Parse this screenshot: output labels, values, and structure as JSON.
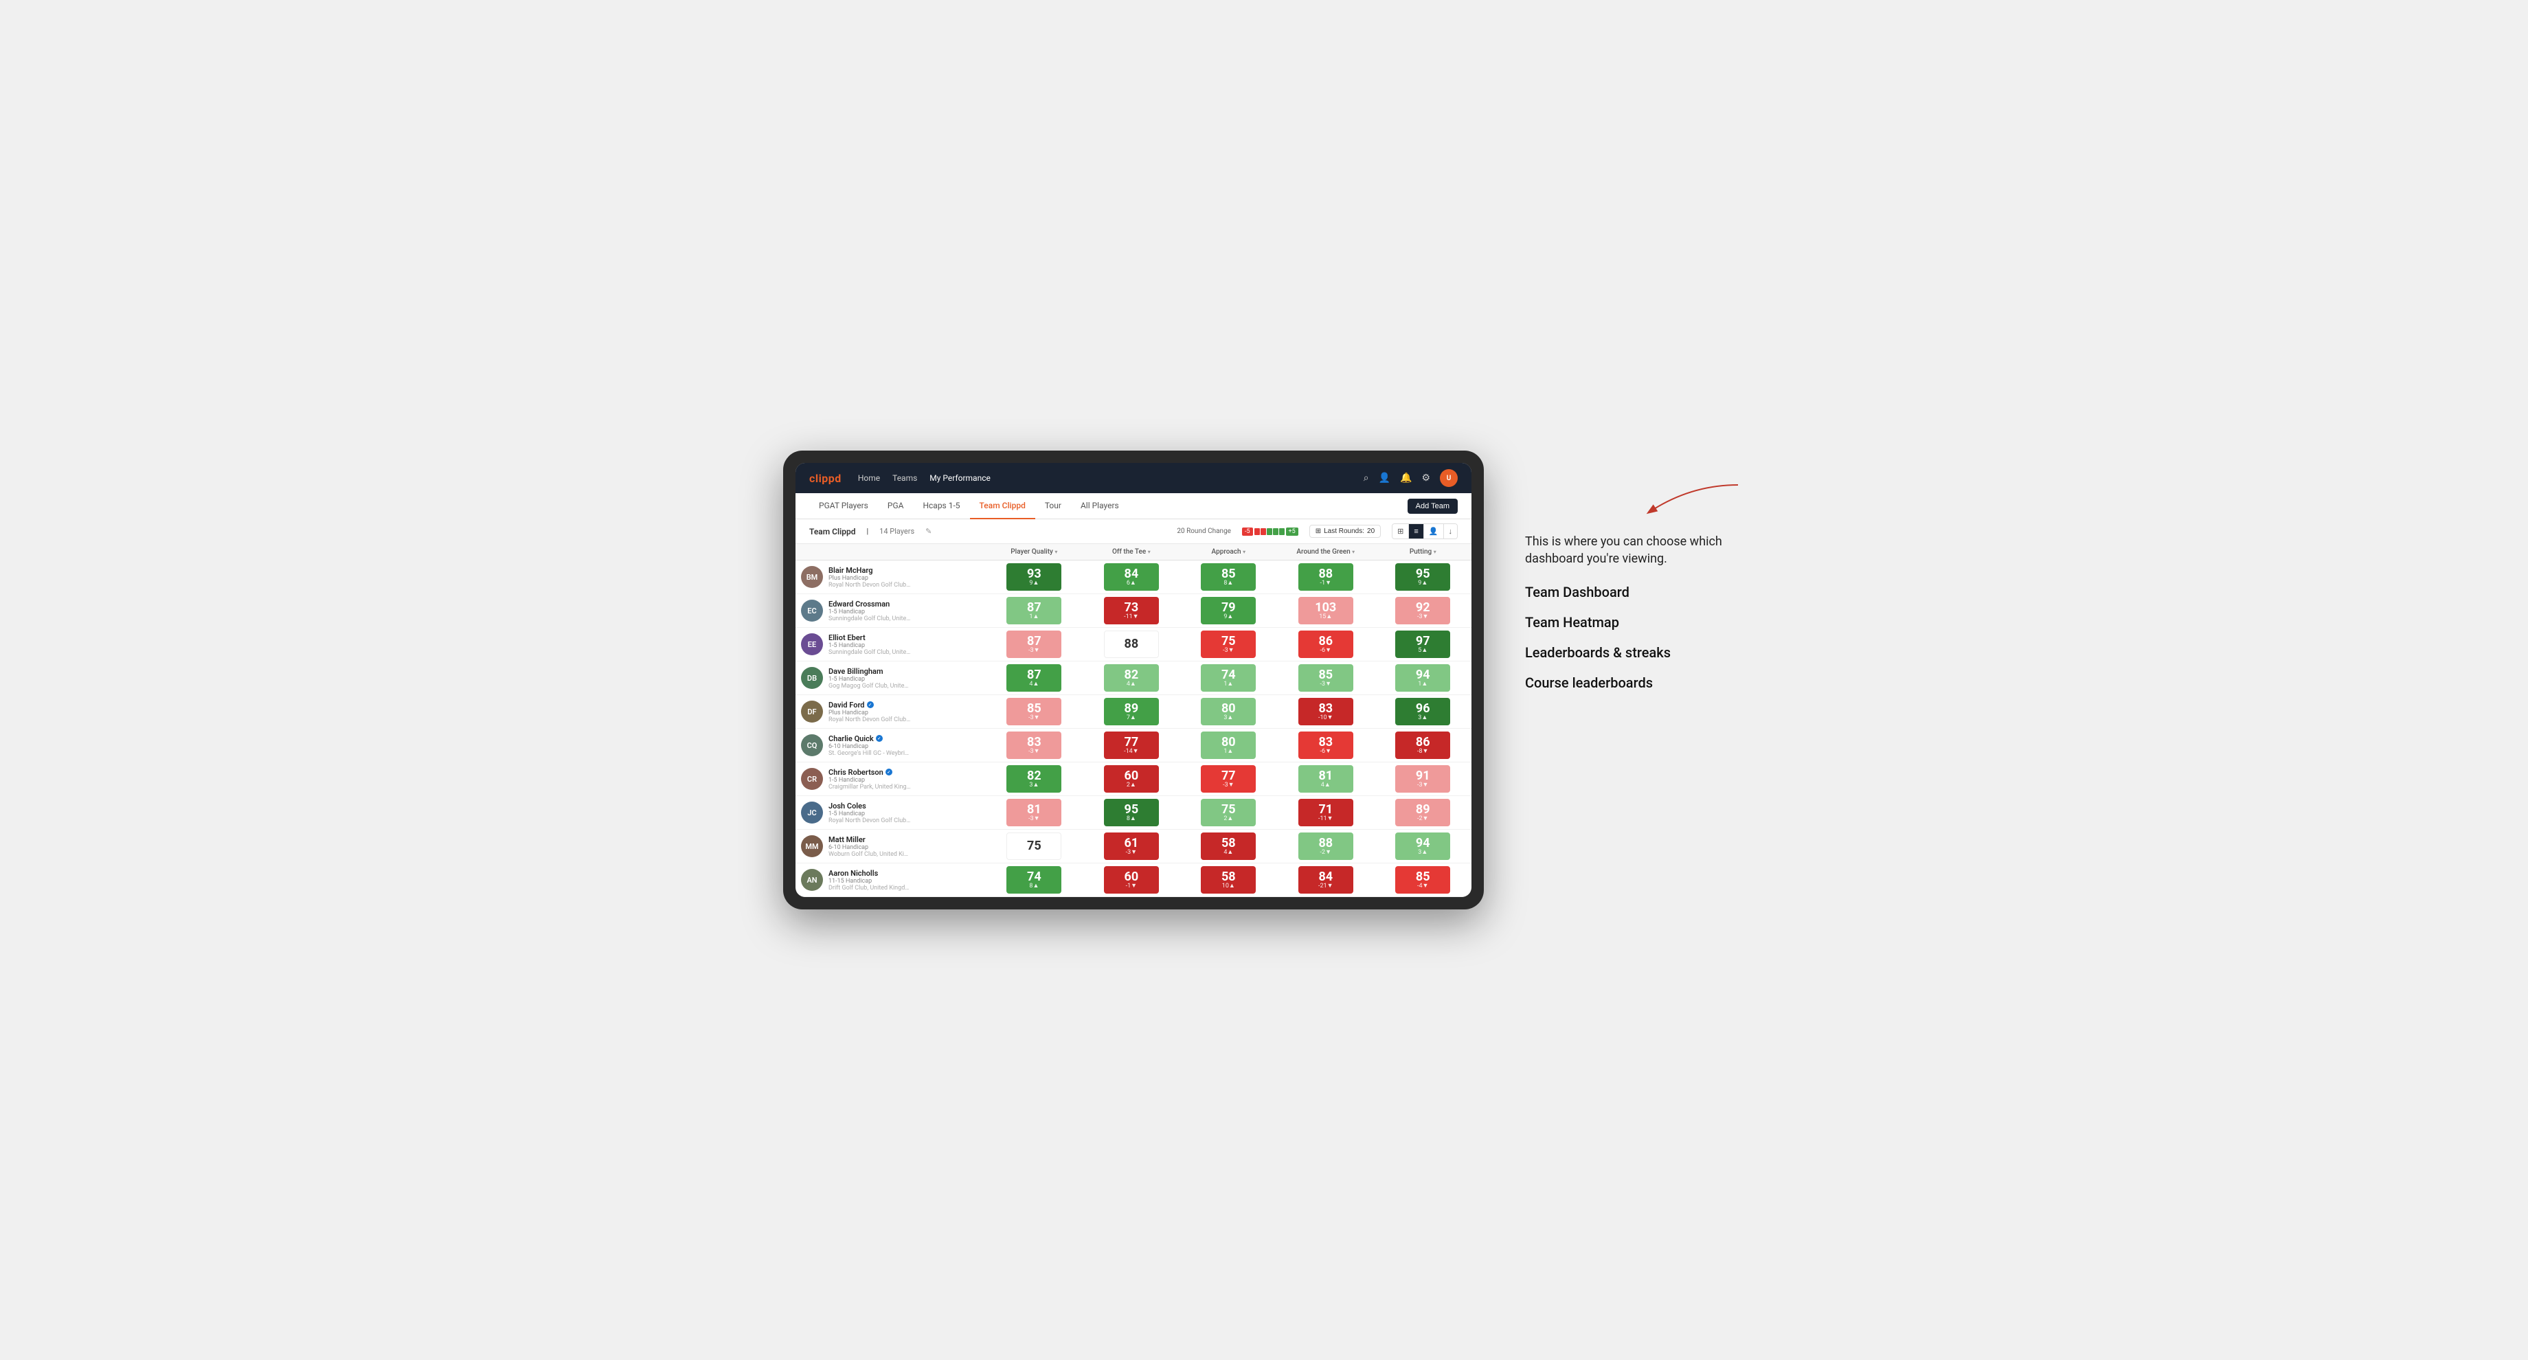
{
  "annotation": {
    "description": "This is where you can choose which dashboard you're viewing.",
    "menu_items": [
      "Team Dashboard",
      "Team Heatmap",
      "Leaderboards & streaks",
      "Course leaderboards"
    ]
  },
  "nav": {
    "logo": "clippd",
    "links": [
      "Home",
      "Teams",
      "My Performance"
    ],
    "active_link": "My Performance"
  },
  "sub_nav": {
    "links": [
      "PGAT Players",
      "PGA",
      "Hcaps 1-5",
      "Team Clippd",
      "Tour",
      "All Players"
    ],
    "active_link": "Team Clippd",
    "add_team_label": "Add Team"
  },
  "team_header": {
    "team_name": "Team Clippd",
    "separator": "|",
    "player_count": "14 Players",
    "round_change_label": "20 Round Change",
    "change_neg": "-5",
    "change_pos": "+5",
    "last_rounds_label": "Last Rounds:",
    "last_rounds_value": "20"
  },
  "table": {
    "columns": [
      {
        "label": "Player Quality",
        "sortable": true
      },
      {
        "label": "Off the Tee",
        "sortable": true
      },
      {
        "label": "Approach",
        "sortable": true
      },
      {
        "label": "Around the Green",
        "sortable": true
      },
      {
        "label": "Putting",
        "sortable": true
      }
    ],
    "players": [
      {
        "name": "Blair McHarg",
        "handicap": "Plus Handicap",
        "club": "Royal North Devon Golf Club, United Kingdom",
        "avatar_color": "#8d6e63",
        "initials": "BM",
        "verified": false,
        "scores": [
          {
            "value": "93",
            "delta": "9▲",
            "color": "green-strong"
          },
          {
            "value": "84",
            "delta": "6▲",
            "color": "green-medium"
          },
          {
            "value": "85",
            "delta": "8▲",
            "color": "green-medium"
          },
          {
            "value": "88",
            "delta": "-1▼",
            "color": "green-medium"
          },
          {
            "value": "95",
            "delta": "9▲",
            "color": "green-strong"
          }
        ]
      },
      {
        "name": "Edward Crossman",
        "handicap": "1-5 Handicap",
        "club": "Sunningdale Golf Club, United Kingdom",
        "avatar_color": "#5d7a8a",
        "initials": "EC",
        "verified": false,
        "scores": [
          {
            "value": "87",
            "delta": "1▲",
            "color": "green-light"
          },
          {
            "value": "73",
            "delta": "-11▼",
            "color": "red-strong"
          },
          {
            "value": "79",
            "delta": "9▲",
            "color": "green-medium"
          },
          {
            "value": "103",
            "delta": "15▲",
            "color": "red-light"
          },
          {
            "value": "92",
            "delta": "-3▼",
            "color": "red-light"
          }
        ]
      },
      {
        "name": "Elliot Ebert",
        "handicap": "1-5 Handicap",
        "club": "Sunningdale Golf Club, United Kingdom",
        "avatar_color": "#6a4c93",
        "initials": "EE",
        "verified": false,
        "scores": [
          {
            "value": "87",
            "delta": "-3▼",
            "color": "red-light"
          },
          {
            "value": "88",
            "delta": "",
            "color": "white"
          },
          {
            "value": "75",
            "delta": "-3▼",
            "color": "red-medium"
          },
          {
            "value": "86",
            "delta": "-6▼",
            "color": "red-medium"
          },
          {
            "value": "97",
            "delta": "5▲",
            "color": "green-strong"
          }
        ]
      },
      {
        "name": "Dave Billingham",
        "handicap": "1-5 Handicap",
        "club": "Gog Magog Golf Club, United Kingdom",
        "avatar_color": "#4a7c59",
        "initials": "DB",
        "verified": false,
        "scores": [
          {
            "value": "87",
            "delta": "4▲",
            "color": "green-medium"
          },
          {
            "value": "82",
            "delta": "4▲",
            "color": "green-light"
          },
          {
            "value": "74",
            "delta": "1▲",
            "color": "green-light"
          },
          {
            "value": "85",
            "delta": "-3▼",
            "color": "green-light"
          },
          {
            "value": "94",
            "delta": "1▲",
            "color": "green-light"
          }
        ]
      },
      {
        "name": "David Ford",
        "handicap": "Plus Handicap",
        "club": "Royal North Devon Golf Club, United Kingdom",
        "avatar_color": "#7b6b4a",
        "initials": "DF",
        "verified": true,
        "scores": [
          {
            "value": "85",
            "delta": "-3▼",
            "color": "red-light"
          },
          {
            "value": "89",
            "delta": "7▲",
            "color": "green-medium"
          },
          {
            "value": "80",
            "delta": "3▲",
            "color": "green-light"
          },
          {
            "value": "83",
            "delta": "-10▼",
            "color": "red-strong"
          },
          {
            "value": "96",
            "delta": "3▲",
            "color": "green-strong"
          }
        ]
      },
      {
        "name": "Charlie Quick",
        "handicap": "6-10 Handicap",
        "club": "St. George's Hill GC - Weybridge - Surrey, Uni...",
        "avatar_color": "#5c7a6b",
        "initials": "CQ",
        "verified": true,
        "scores": [
          {
            "value": "83",
            "delta": "-3▼",
            "color": "red-light"
          },
          {
            "value": "77",
            "delta": "-14▼",
            "color": "red-strong"
          },
          {
            "value": "80",
            "delta": "1▲",
            "color": "green-light"
          },
          {
            "value": "83",
            "delta": "-6▼",
            "color": "red-medium"
          },
          {
            "value": "86",
            "delta": "-8▼",
            "color": "red-strong"
          }
        ]
      },
      {
        "name": "Chris Robertson",
        "handicap": "1-5 Handicap",
        "club": "Craigmillar Park, United Kingdom",
        "avatar_color": "#8b5e52",
        "initials": "CR",
        "verified": true,
        "scores": [
          {
            "value": "82",
            "delta": "3▲",
            "color": "green-medium"
          },
          {
            "value": "60",
            "delta": "2▲",
            "color": "red-strong"
          },
          {
            "value": "77",
            "delta": "-3▼",
            "color": "red-medium"
          },
          {
            "value": "81",
            "delta": "4▲",
            "color": "green-light"
          },
          {
            "value": "91",
            "delta": "-3▼",
            "color": "red-light"
          }
        ]
      },
      {
        "name": "Josh Coles",
        "handicap": "1-5 Handicap",
        "club": "Royal North Devon Golf Club, United Kingdom",
        "avatar_color": "#4a6b8a",
        "initials": "JC",
        "verified": false,
        "scores": [
          {
            "value": "81",
            "delta": "-3▼",
            "color": "red-light"
          },
          {
            "value": "95",
            "delta": "8▲",
            "color": "green-strong"
          },
          {
            "value": "75",
            "delta": "2▲",
            "color": "green-light"
          },
          {
            "value": "71",
            "delta": "-11▼",
            "color": "red-strong"
          },
          {
            "value": "89",
            "delta": "-2▼",
            "color": "red-light"
          }
        ]
      },
      {
        "name": "Matt Miller",
        "handicap": "6-10 Handicap",
        "club": "Woburn Golf Club, United Kingdom",
        "avatar_color": "#7a5c4a",
        "initials": "MM",
        "verified": false,
        "scores": [
          {
            "value": "75",
            "delta": "",
            "color": "white"
          },
          {
            "value": "61",
            "delta": "-3▼",
            "color": "red-strong"
          },
          {
            "value": "58",
            "delta": "4▲",
            "color": "red-strong"
          },
          {
            "value": "88",
            "delta": "-2▼",
            "color": "green-light"
          },
          {
            "value": "94",
            "delta": "3▲",
            "color": "green-light"
          }
        ]
      },
      {
        "name": "Aaron Nicholls",
        "handicap": "11-15 Handicap",
        "club": "Drift Golf Club, United Kingdom",
        "avatar_color": "#6b7a5c",
        "initials": "AN",
        "verified": false,
        "scores": [
          {
            "value": "74",
            "delta": "8▲",
            "color": "green-medium"
          },
          {
            "value": "60",
            "delta": "-1▼",
            "color": "red-strong"
          },
          {
            "value": "58",
            "delta": "10▲",
            "color": "red-strong"
          },
          {
            "value": "84",
            "delta": "-21▼",
            "color": "red-strong"
          },
          {
            "value": "85",
            "delta": "-4▼",
            "color": "red-medium"
          }
        ]
      }
    ]
  }
}
